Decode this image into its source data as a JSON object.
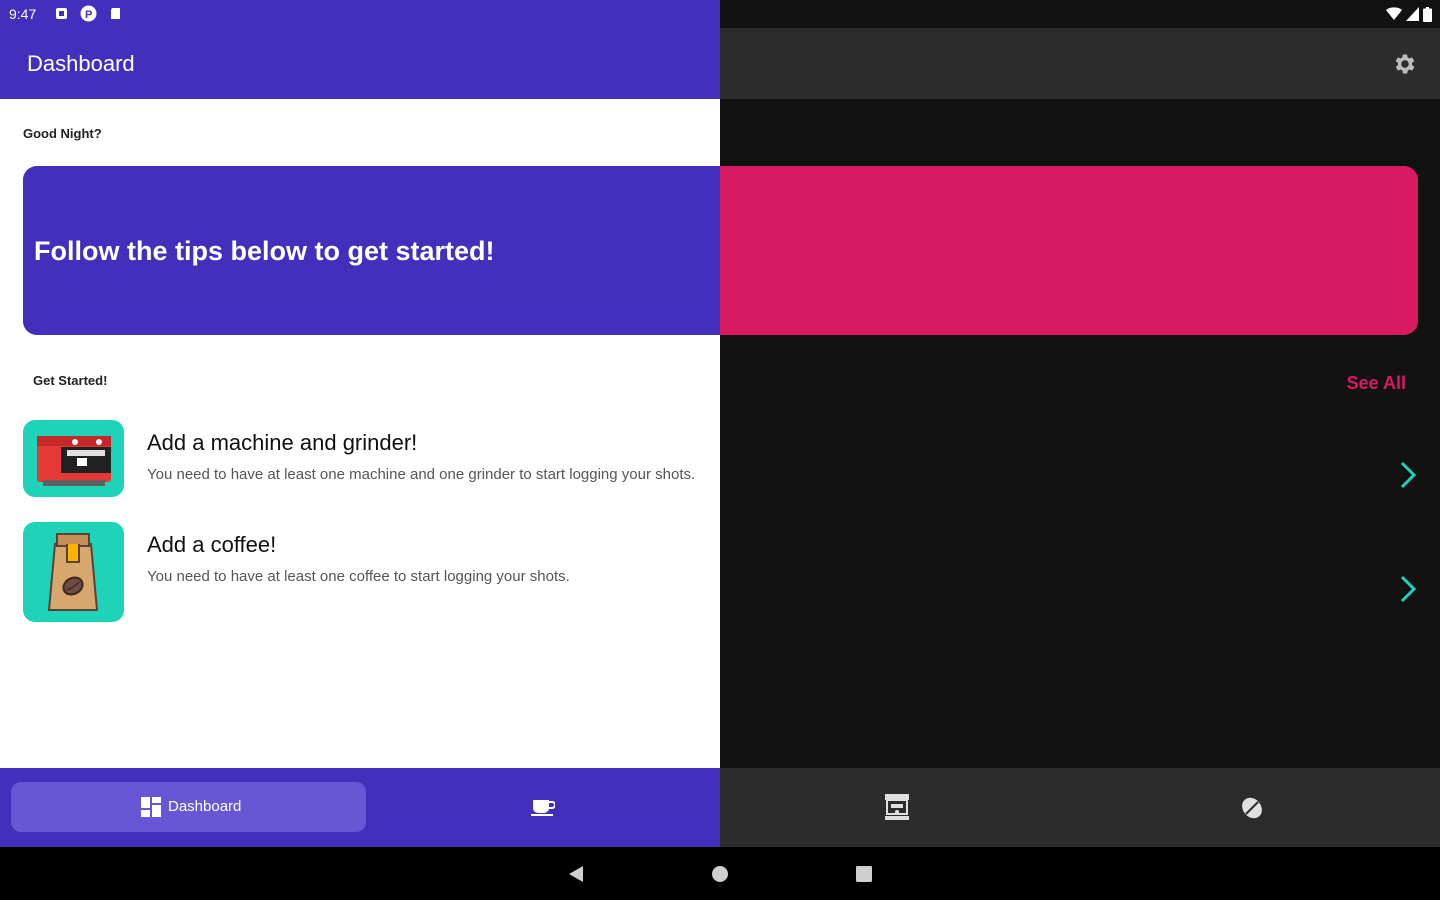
{
  "status_bar": {
    "time": "9:47"
  },
  "app_bar": {
    "title": "Dashboard"
  },
  "content": {
    "greeting": "Good Night?",
    "banner_text": "Follow the tips below to get started!",
    "section_title": "Get Started!",
    "see_all": "See All",
    "tips": [
      {
        "title": "Add a machine and grinder!",
        "description": "You need to have at least one machine and one grinder to start logging your shots.",
        "icon": "espresso-machine-icon"
      },
      {
        "title": "Add a coffee!",
        "description": "You need to have at least one coffee to start logging your shots.",
        "icon": "coffee-bag-icon"
      }
    ]
  },
  "bottom_nav": {
    "active_label": "Dashboard",
    "items": [
      "dashboard-icon",
      "coffee-cup-icon",
      "grinder-icon",
      "coffee-bean-icon"
    ]
  },
  "colors": {
    "primary": "#4230bd",
    "accent": "#d81b60",
    "teal": "#1fd3b8",
    "dark_bg": "#121212",
    "dark_surface": "#2c2c2c"
  }
}
